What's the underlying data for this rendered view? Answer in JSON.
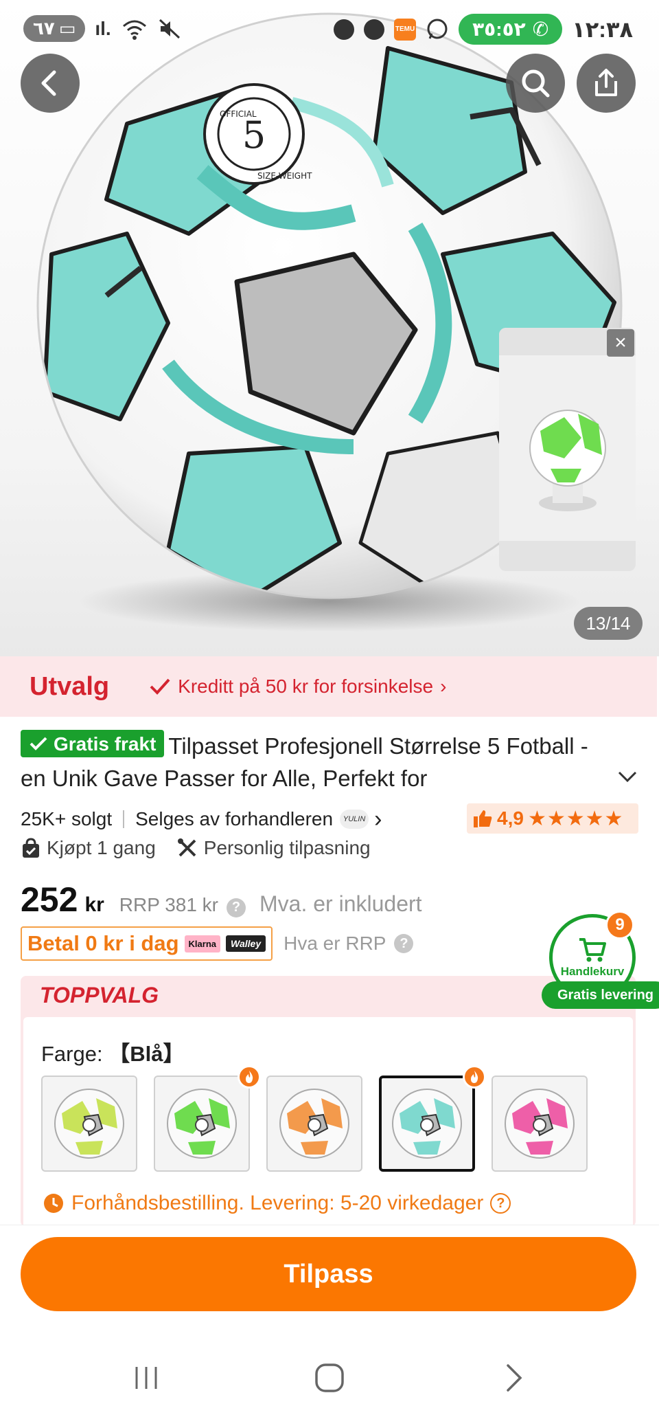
{
  "status_bar": {
    "battery": "٦٧",
    "call_timer": "٣٥:٥٢",
    "time": "١٢:٣٨",
    "signal_text": "ıl.",
    "temu_label": "TEMU"
  },
  "gallery": {
    "counter": "13/14",
    "product_image": "white-teal-football",
    "video_preview": "green-football-video"
  },
  "promo": {
    "title": "Utvalg",
    "text": "Kreditt på 50 kr for forsinkelse"
  },
  "product": {
    "free_shipping_badge": "Gratis frakt",
    "title": "Tilpasset Profesjonell Størrelse 5 Fotball - en Unik Gave Passer for Alle, Perfekt for",
    "sold": "25K+ solgt",
    "seller_text": "Selges av forhandleren",
    "seller_logo": "YULIN",
    "rating": "4,9",
    "rating_value": 4.9,
    "stars": "★★★★★",
    "bought_tag": "Kjøpt 1 gang",
    "custom_tag": "Personlig tilpasning"
  },
  "price": {
    "amount": "252",
    "unit": "kr",
    "rrp": "RRP 381 kr",
    "vat": "Mva. er inkludert",
    "pay_later": "Betal 0 kr i dag",
    "klarna": "Klarna",
    "walley": "Walley",
    "rrp_help": "Hva er RRP"
  },
  "cart": {
    "count": "9",
    "label": "Handlekurv",
    "delivery": "Gratis levering"
  },
  "top_pick": {
    "title": "TOPPVALG",
    "color_label": "Farge:",
    "color_value": "【Blå】",
    "swatches": [
      {
        "name": "yellow",
        "color": "#c9e35a",
        "hot": false,
        "selected": false
      },
      {
        "name": "green",
        "color": "#6fdc4f",
        "hot": true,
        "selected": false
      },
      {
        "name": "orange",
        "color": "#f39a4c",
        "hot": false,
        "selected": false
      },
      {
        "name": "blue",
        "color": "#7fd9cf",
        "hot": true,
        "selected": true
      },
      {
        "name": "pink",
        "color": "#ee5fa8",
        "hot": false,
        "selected": false
      }
    ],
    "preorder": "Forhåndsbestilling. Levering: 5-20 virkedager"
  },
  "cta": {
    "label": "Tilpass"
  },
  "colors": {
    "accent_orange": "#fb7701",
    "promo_red": "#d4232f",
    "green": "#1aa02d",
    "ball_teal": "#7fd9cf"
  }
}
